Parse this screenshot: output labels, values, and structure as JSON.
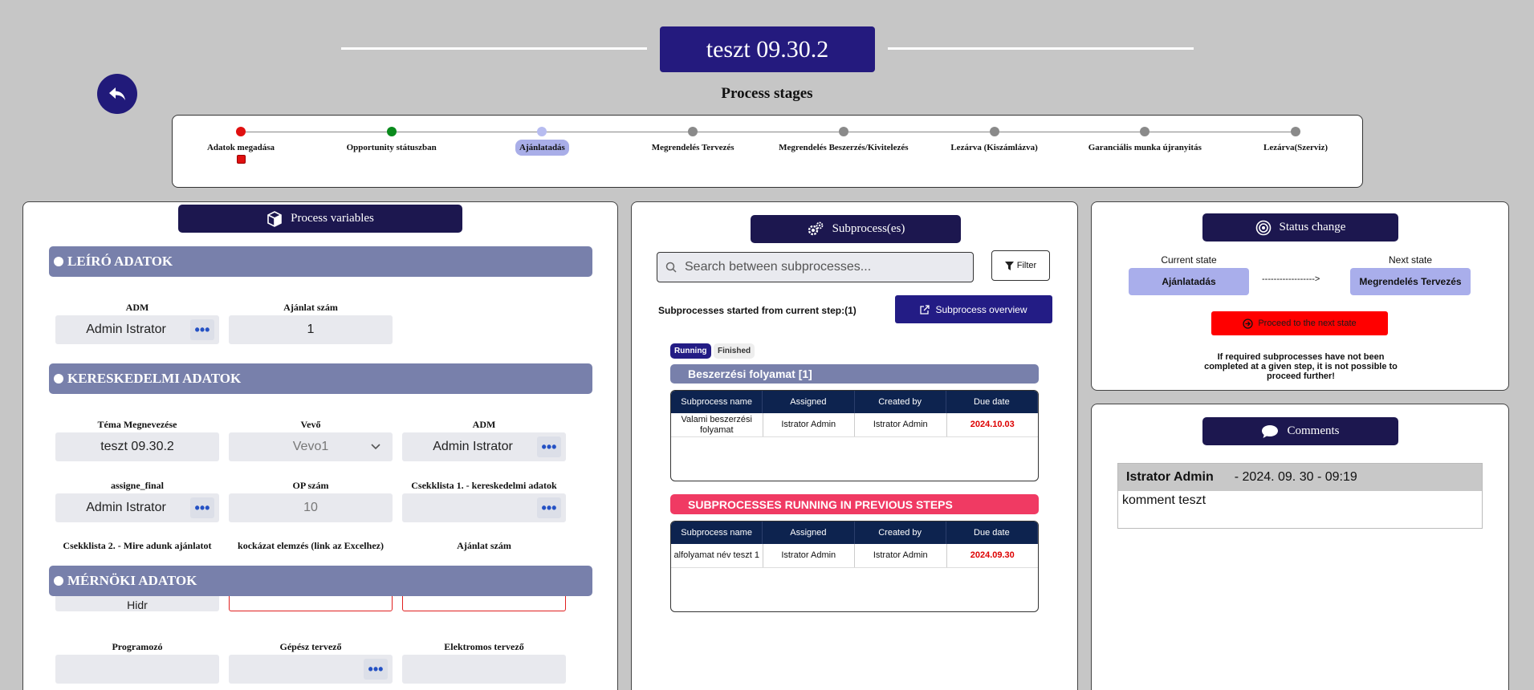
{
  "header": {
    "title": "teszt 09.30.2",
    "stages_title": "Process stages"
  },
  "stages": [
    {
      "label": "Adatok megadása",
      "color": "#e01010",
      "active": false,
      "badge": true
    },
    {
      "label": "Opportunity státuszban",
      "color": "#0a8a1c",
      "active": false,
      "badge": false
    },
    {
      "label": "Ajánlatadás",
      "color": "#b7bcf0",
      "active": true,
      "badge": false
    },
    {
      "label": "Megrendelés Tervezés",
      "color": "#8a8a8a",
      "active": false,
      "badge": false
    },
    {
      "label": "Megrendelés Beszerzés/Kivitelezés",
      "color": "#8a8a8a",
      "active": false,
      "badge": false
    },
    {
      "label": "Lezárva (Kiszámlázva)",
      "color": "#8a8a8a",
      "active": false,
      "badge": false
    },
    {
      "label": "Garanciális munka újranyitás",
      "color": "#8a8a8a",
      "active": false,
      "badge": false
    },
    {
      "label": "Lezárva(Szerviz)",
      "color": "#8a8a8a",
      "active": false,
      "badge": false
    }
  ],
  "process_variables": {
    "title": "Process variables",
    "sec1": "LEÍRÓ ADATOK",
    "sec2": "KERESKEDELMI ADATOK",
    "sec3": "MÉRNÖKI ADATOK",
    "f_adm1_label": "ADM",
    "f_adm1_value": "Admin Istrator",
    "f_ajanlat1_label": "Ajánlat szám",
    "f_ajanlat1_value": "1",
    "f_tema_label": "Téma Megnevezése",
    "f_tema_value": "teszt 09.30.2",
    "f_vevo_label": "Vevő",
    "f_vevo_value": "Vevo1",
    "f_adm2_label": "ADM",
    "f_adm2_value": "Admin Istrator",
    "f_assign_label": "assigne_final",
    "f_assign_value": "Admin Istrator",
    "f_op_label": "OP szám",
    "f_op_value": "10",
    "f_csek1_label": "Csekklista 1. - kereskedelmi adatok",
    "f_csek2_label": "Csekklista 2. - Mire adunk ajánlatot",
    "f_kock_label": "kockázat elemzés (link az Excelhez)",
    "f_ajanlat2_label": "Ajánlat szám",
    "f_partial_value": "Hidr",
    "f_prog_label": "Programozó",
    "f_gepesz_label": "Gépész tervező",
    "f_elektro_label": "Elektromos tervező",
    "dots": "•••"
  },
  "subprocess": {
    "title": "Subprocess(es)",
    "search_placeholder": "Search between subprocesses...",
    "filter_label": "Filter",
    "started_text": "Subprocesses started from current step:(1)",
    "overview_label": "Subprocess overview",
    "tab_running": "Running",
    "tab_finished": "Finished",
    "group_title": "Beszerzési folyamat [1]",
    "headers": [
      "Subprocess name",
      "Assigned",
      "Created by",
      "Due date"
    ],
    "rows": [
      {
        "name": "Valami beszerzési folyamat",
        "assigned": "Istrator Admin",
        "created": "Istrator Admin",
        "due": "2024.10.03"
      }
    ],
    "prev_title": "SUBPROCESSES RUNNING IN PREVIOUS STEPS",
    "prev_rows": [
      {
        "name": "alfolyamat név teszt 1",
        "assigned": "Istrator Admin",
        "created": "Istrator Admin",
        "due": "2024.09.30"
      }
    ]
  },
  "status": {
    "title": "Status change",
    "current_label": "Current state",
    "current_value": "Ajánlatadás",
    "next_label": "Next state",
    "next_value": "Megrendelés Tervezés",
    "arrow": "------------------>",
    "proceed_label": "Proceed to the next state",
    "note": "If required subprocesses have not been completed at a given step, it is not possible to proceed further!"
  },
  "comments": {
    "title": "Comments",
    "author": "Istrator Admin",
    "date": "- 2024. 09. 30 - 09:19",
    "text": "komment teszt"
  },
  "colors": {
    "navy": "#1c174f",
    "accent": "#241a7e",
    "red": "#ff0000",
    "pink": "#f03a63",
    "section": "#7880ab"
  }
}
